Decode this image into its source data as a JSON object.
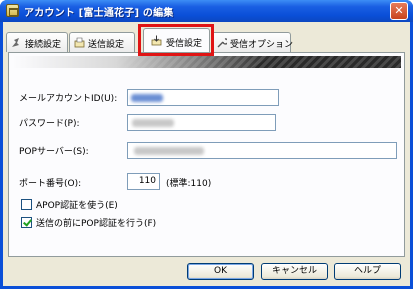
{
  "window": {
    "title": "アカウント [富士通花子] の編集",
    "close_glyph": "✕"
  },
  "tabs": [
    {
      "label": "接続設定",
      "icon": "connection-icon",
      "active": false
    },
    {
      "label": "送信設定",
      "icon": "send-icon",
      "active": false
    },
    {
      "label": "受信設定",
      "icon": "receive-icon",
      "active": true
    },
    {
      "label": "受信オプション",
      "icon": "wrench-icon",
      "active": false
    }
  ],
  "highlight_color": "#e01414",
  "form": {
    "account_id_label": "メールアカウントID(U):",
    "password_label": "パスワード(P):",
    "pop_server_label": "POPサーバー(S):",
    "port_label": "ポート番号(O):",
    "port_value": "110",
    "port_hint": "(標準:110)",
    "apop_label": "APOP認証を使う(E)",
    "apop_checked": false,
    "pop_before_label": "送信の前にPOP認証を行う(F)",
    "pop_before_checked": true
  },
  "buttons": {
    "ok": "OK",
    "cancel": "キャンセル",
    "help": "ヘルプ"
  }
}
